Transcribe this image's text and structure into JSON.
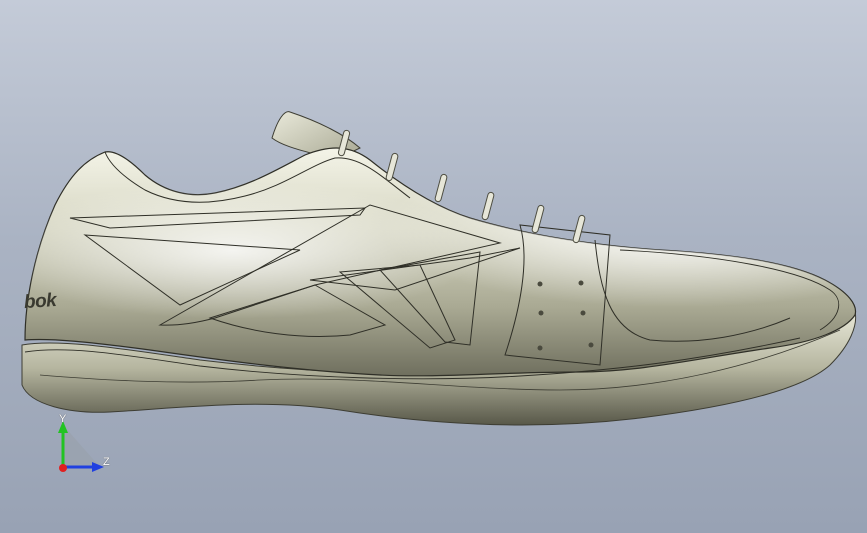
{
  "viewport": {
    "model": "shoe",
    "background_gradient": [
      "#c4cbd8",
      "#98a2b4"
    ],
    "model_color": "#c9c9b2"
  },
  "model": {
    "brand_text": "bok"
  },
  "triad": {
    "y_label": "Y",
    "z_label": "Z",
    "y_color": "#22c322",
    "z_color": "#2040e0",
    "x_color": "#e02020"
  }
}
